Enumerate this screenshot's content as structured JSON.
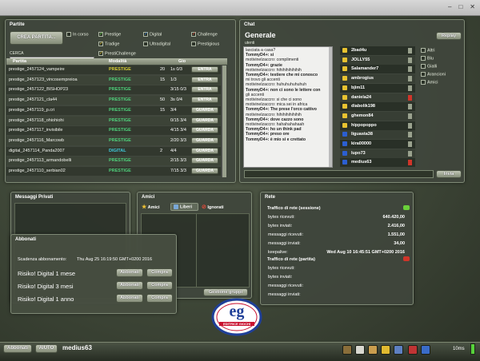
{
  "partite": {
    "title": "Partite",
    "create_button": "CREA PARTITA...",
    "search_label": "CERCA",
    "filters": {
      "in_corso": "In corso",
      "prestige": "Prestige",
      "digital": "Digital",
      "challenge": "Challenge",
      "tradige": "Tradige",
      "ultradigital": "Ultradigital",
      "prestigious": "Prestigious",
      "prestichallenge": "PrestiChallenge"
    },
    "columns": [
      "Partita",
      "Modalità",
      "Gio"
    ],
    "rows": [
      {
        "name": "prestige_2457124_vampeire",
        "mode": "PRESTIGE",
        "mode_class": "prestige",
        "count": "20",
        "players": "1s 0/3",
        "action": "ENTRA"
      },
      {
        "name": "prestige_2457123_vincosempreioa",
        "mode": "PRESTIGE",
        "mode_class": "standard",
        "count": "15",
        "players": "1/3",
        "action": "ENTRA"
      },
      {
        "name": "prestige_2457122_BISHOP23",
        "mode": "PRESTIGE",
        "mode_class": "standard",
        "count": "",
        "players": "3/15 0/3",
        "action": "ENTRA"
      },
      {
        "name": "prestige_2457121_cla44",
        "mode": "PRESTIGE",
        "mode_class": "standard",
        "count": "50",
        "players": "3s 0/4",
        "action": "ENTRA"
      },
      {
        "name": "prestige_2457119_p.cri",
        "mode": "PRESTIGE",
        "mode_class": "standard",
        "count": "15",
        "players": "3/4",
        "action": "GUARDA"
      },
      {
        "name": "prestige_2457118_ohiohiohi",
        "mode": "PRESTIGE",
        "mode_class": "standard",
        "count": "",
        "players": "0/15 3/4",
        "action": "GUARDA"
      },
      {
        "name": "prestige_2457117_invisibile",
        "mode": "PRESTIGE",
        "mode_class": "standard",
        "count": "",
        "players": "4/15 3/4",
        "action": "GUARDA"
      },
      {
        "name": "prestige_2457116_Marcowb",
        "mode": "PRESTIGE",
        "mode_class": "standard",
        "count": "",
        "players": "2/20 3/3",
        "action": "GUARDA"
      },
      {
        "name": "digital_2457114_Panda2007",
        "mode": "DIGITAL",
        "mode_class": "digital",
        "count": "2",
        "players": "4/4",
        "action": "GUARDA"
      },
      {
        "name": "prestige_2457113_armandobelli",
        "mode": "PRESTIGE",
        "mode_class": "standard",
        "count": "",
        "players": "2/15 3/3",
        "action": "GUARDA"
      },
      {
        "name": "prestige_2457110_serbian02",
        "mode": "PRESTIGE",
        "mode_class": "standard",
        "count": "",
        "players": "7/15 3/3",
        "action": "GUARDA"
      }
    ]
  },
  "chat": {
    "title": "Chat",
    "room": "Generale",
    "subtitle": "utenti",
    "replay_button": "Replay",
    "send_button": "Invia",
    "lines": [
      {
        "t": "lasciata a casa?",
        "b": false
      },
      {
        "t": "TommyD4+: si",
        "b": true
      },
      {
        "t": "motivinelzaccro: complimenti",
        "b": false
      },
      {
        "t": "TommyD4+: grazie",
        "b": true
      },
      {
        "t": "motivinelzaccro: hihihihihihihih",
        "b": false
      },
      {
        "t": "TommyD4+: testiere che mi conosco",
        "b": true
      },
      {
        "t": "mi trovo gli accenti",
        "b": false
      },
      {
        "t": "motivinelzaccro: huhuhuhuhuhuh",
        "b": false
      },
      {
        "t": "TommyD4+: non ci sono le lettere con",
        "b": true
      },
      {
        "t": "gli accenti",
        "b": false
      },
      {
        "t": "motivinelzaccro: si che ci sono",
        "b": false
      },
      {
        "t": "motivinelzaccro: mica sei in africa",
        "b": false
      },
      {
        "t": "TommyD4+: The prese l'orco cattivo",
        "b": true
      },
      {
        "t": "motivinelzaccro: hihihihihihihih",
        "b": false
      },
      {
        "t": "TommyD4+: dove cazzo sono",
        "b": true
      },
      {
        "t": "motivinelzaccro: hahahahahaah",
        "b": false
      },
      {
        "t": "TommyD4+: ho un think pad",
        "b": true
      },
      {
        "t": "TommyD4+: preso ore",
        "b": true
      },
      {
        "t": "TommyD4+: è mio si e crettato",
        "b": true
      }
    ],
    "users": [
      {
        "name": "2bad4u",
        "dice": "#e8c230",
        "status": "#9aa28e"
      },
      {
        "name": "JOLLY55",
        "dice": "#e8c230",
        "status": "#9aa28e"
      },
      {
        "name": "Salamander7",
        "dice": "#e8c230",
        "status": "#9aa28e"
      },
      {
        "name": "ambrogius",
        "dice": "#e8c230",
        "status": "#9aa28e"
      },
      {
        "name": "bjim11",
        "dice": "#e8c230",
        "status": "#9aa28e"
      },
      {
        "name": "daniela24",
        "dice": "#e8c230",
        "status": "#d0352a"
      },
      {
        "name": "diabolik198",
        "dice": "#e8c230",
        "status": "#9aa28e"
      },
      {
        "name": "ghemon84",
        "dice": "#e8c230",
        "status": "#9aa28e"
      },
      {
        "name": "hippopoppo",
        "dice": "#e8c230",
        "status": "#9aa28e"
      },
      {
        "name": "liguasta38",
        "dice": "#2c5fd1",
        "status": "#9aa28e"
      },
      {
        "name": "kira00000",
        "dice": "#2c5fd1",
        "status": "#9aa28e"
      },
      {
        "name": "lupo73",
        "dice": "#2c5fd1",
        "status": "#9aa28e"
      },
      {
        "name": "medius63",
        "dice": "#2c5fd1",
        "status": "#d0352a"
      }
    ],
    "filters": [
      "Altri",
      "Blu",
      "Gialli",
      "Arancioni",
      "Amici"
    ]
  },
  "messaggi": {
    "title": "Messaggi Privati"
  },
  "amici": {
    "title": "Amici",
    "tab_amici": "Amici",
    "tab_liberi": "Liberi",
    "tab_ignorati": "Ignorati",
    "manage_button": "Gestione gruppi"
  },
  "abbonati": {
    "title": "Abbonati",
    "expiry_label": "Scadenza abbonamento:",
    "expiry_value": "Thu Aug 25 16:19:50 GMT+0200 2016",
    "plans": [
      {
        "name": "Risiko! Digital 1 mese",
        "subscribe": "Abbonati",
        "buy": "Compra"
      },
      {
        "name": "Risiko! Digital 3 mesi",
        "subscribe": "Abbonati",
        "buy": "Compra"
      },
      {
        "name": "Risiko! Digital 1 anno",
        "subscribe": "Abbonati",
        "buy": "Compra"
      }
    ]
  },
  "rete": {
    "title": "Rete",
    "session_title": "Traffico di rete (sessione)",
    "partita_title": "Traffico di rete (partita)",
    "session": [
      {
        "label": "bytes ricevuti:",
        "value": "640.420,00"
      },
      {
        "label": "bytes inviati:",
        "value": "2.416,00"
      },
      {
        "label": "messaggi ricevuti:",
        "value": "1.551,00"
      },
      {
        "label": "messaggi inviati:",
        "value": "34,00"
      },
      {
        "label": "keepalive:",
        "value": "Wed Aug 10 16:45:51 GMT+0200 2016"
      }
    ],
    "partita": [
      {
        "label": "bytes ricevuti:",
        "value": ""
      },
      {
        "label": "bytes inviati:",
        "value": ""
      },
      {
        "label": "messaggi ricevuti:",
        "value": ""
      },
      {
        "label": "messaggi inviati:",
        "value": ""
      }
    ]
  },
  "logo": {
    "letters": "eg",
    "subtitle": "EDITRICE GIOCHI"
  },
  "bottombar": {
    "abbonati_button": "Abbonati",
    "aiuto_button": "AIUTO",
    "username": "medius63",
    "ping": "10ms"
  },
  "colors": {
    "accent_green": "#57d13b",
    "prestige_yellow": "#d7cd36",
    "digital_cyan": "#3ecbdd",
    "standard_green": "#4fd07b"
  }
}
